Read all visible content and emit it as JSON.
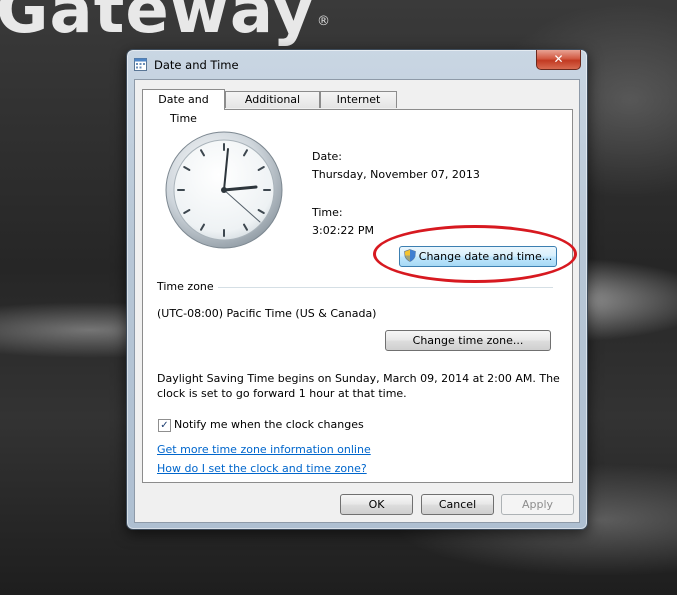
{
  "desktop": {
    "brand": "Gateway",
    "registered_mark": "®"
  },
  "window": {
    "title": "Date and Time",
    "close_glyph": "✕"
  },
  "tabs": [
    {
      "label": "Date and Time",
      "active": true
    },
    {
      "label": "Additional Clocks",
      "active": false
    },
    {
      "label": "Internet Time",
      "active": false
    }
  ],
  "date": {
    "label": "Date:",
    "value": "Thursday, November 07, 2013"
  },
  "time": {
    "label": "Time:",
    "value": "3:02:22 PM"
  },
  "change_datetime_button": "Change date and time...",
  "timezone": {
    "heading": "Time zone",
    "value": "(UTC-08:00) Pacific Time (US & Canada)",
    "change_button": "Change time zone..."
  },
  "dst": {
    "line1": "Daylight Saving Time begins on Sunday, March 09, 2014 at 2:00 AM. The",
    "line2": "clock is set to go forward 1 hour at that time."
  },
  "notify": {
    "label": "Notify me when the clock changes",
    "checked": true,
    "mark": "✓"
  },
  "links": {
    "more_info": "Get more time zone information online",
    "how_to": "How do I set the clock and time zone?"
  },
  "footer": {
    "ok": "OK",
    "cancel": "Cancel",
    "apply": "Apply"
  },
  "colors": {
    "annotation_ring": "#d71920",
    "link": "#0066cc",
    "close_button": "#c23a22"
  }
}
